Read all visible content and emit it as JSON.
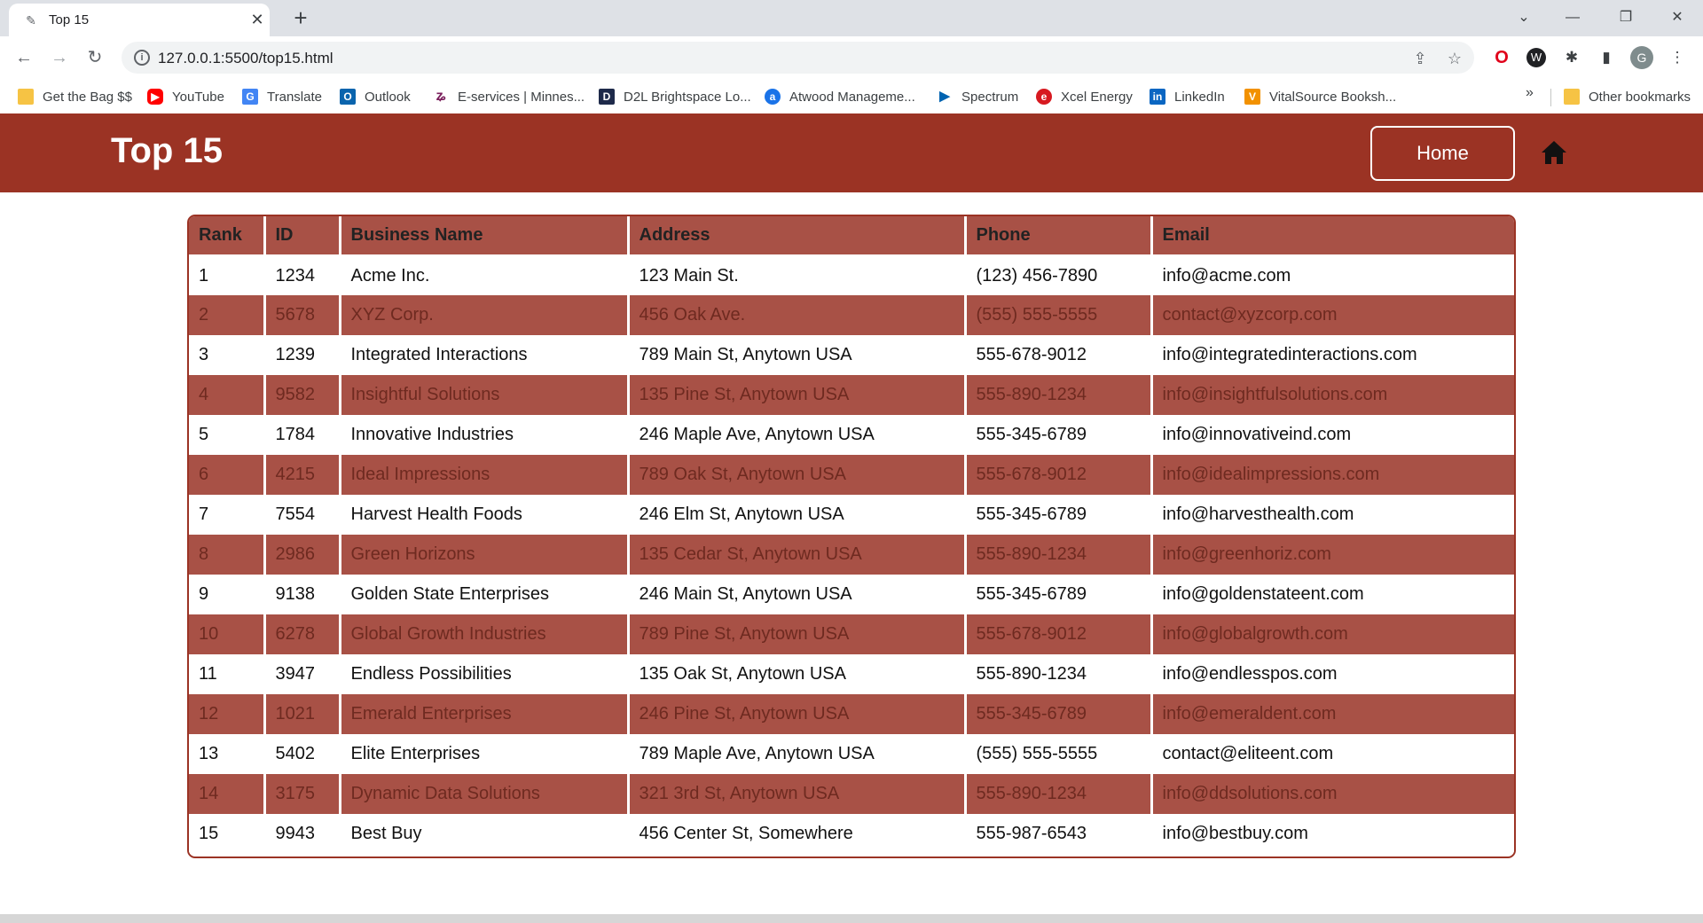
{
  "browser": {
    "tab_title": "Top 15",
    "url": "127.0.0.1:5500/top15.html",
    "bookmarks": [
      {
        "label": "Get the Bag $$",
        "icon": "folder-icon",
        "color": "#f6c344"
      },
      {
        "label": "YouTube",
        "icon": "youtube-icon",
        "color": "#ff0000"
      },
      {
        "label": "Translate",
        "icon": "translate-icon",
        "color": "#4285f4"
      },
      {
        "label": "Outlook",
        "icon": "outlook-icon",
        "color": "#0a64ad"
      },
      {
        "label": "E-services | Minnes...",
        "icon": "eservices-icon",
        "color": "#7a1f5c"
      },
      {
        "label": "D2L Brightspace Lo...",
        "icon": "d2l-icon",
        "color": "#1e2a4a"
      },
      {
        "label": "Atwood Manageme...",
        "icon": "atwood-icon",
        "color": "#1a73e8"
      },
      {
        "label": "Spectrum",
        "icon": "spectrum-icon",
        "color": "#0063b1"
      },
      {
        "label": "Xcel Energy",
        "icon": "xcel-icon",
        "color": "#d71920"
      },
      {
        "label": "LinkedIn",
        "icon": "linkedin-icon",
        "color": "#0a66c2"
      },
      {
        "label": "VitalSource Booksh...",
        "icon": "vitalsource-icon",
        "color": "#f29100"
      }
    ],
    "more_chevron": "»",
    "other_bookmarks": "Other bookmarks",
    "avatar_letter": "G"
  },
  "header": {
    "title": "Top 15",
    "home_label": "Home",
    "accent": "#9b3324"
  },
  "table": {
    "columns": [
      "Rank",
      "ID",
      "Business Name",
      "Address",
      "Phone",
      "Email"
    ],
    "rows": [
      [
        "1",
        "1234",
        "Acme Inc.",
        "123 Main St.",
        "(123) 456-7890",
        "info@acme.com"
      ],
      [
        "2",
        "5678",
        "XYZ Corp.",
        "456 Oak Ave.",
        "(555) 555-5555",
        "contact@xyzcorp.com"
      ],
      [
        "3",
        "1239",
        "Integrated Interactions",
        "789 Main St, Anytown USA",
        "555-678-9012",
        "info@integratedinteractions.com"
      ],
      [
        "4",
        "9582",
        "Insightful Solutions",
        "135 Pine St, Anytown USA",
        "555-890-1234",
        "info@insightfulsolutions.com"
      ],
      [
        "5",
        "1784",
        "Innovative Industries",
        "246 Maple Ave, Anytown USA",
        "555-345-6789",
        "info@innovativeind.com"
      ],
      [
        "6",
        "4215",
        "Ideal Impressions",
        "789 Oak St, Anytown USA",
        "555-678-9012",
        "info@idealimpressions.com"
      ],
      [
        "7",
        "7554",
        "Harvest Health Foods",
        "246 Elm St, Anytown USA",
        "555-345-6789",
        "info@harvesthealth.com"
      ],
      [
        "8",
        "2986",
        "Green Horizons",
        "135 Cedar St, Anytown USA",
        "555-890-1234",
        "info@greenhoriz.com"
      ],
      [
        "9",
        "9138",
        "Golden State Enterprises",
        "246 Main St, Anytown USA",
        "555-345-6789",
        "info@goldenstateent.com"
      ],
      [
        "10",
        "6278",
        "Global Growth Industries",
        "789 Pine St, Anytown USA",
        "555-678-9012",
        "info@globalgrowth.com"
      ],
      [
        "11",
        "3947",
        "Endless Possibilities",
        "135 Oak St, Anytown USA",
        "555-890-1234",
        "info@endlesspos.com"
      ],
      [
        "12",
        "1021",
        "Emerald Enterprises",
        "246 Pine St, Anytown USA",
        "555-345-6789",
        "info@emeraldent.com"
      ],
      [
        "13",
        "5402",
        "Elite Enterprises",
        "789 Maple Ave, Anytown USA",
        "(555) 555-5555",
        "contact@eliteent.com"
      ],
      [
        "14",
        "3175",
        "Dynamic Data Solutions",
        "321 3rd St, Anytown USA",
        "555-890-1234",
        "info@ddsolutions.com"
      ],
      [
        "15",
        "9943",
        "Best Buy",
        "456 Center St, Somewhere",
        "555-987-6543",
        "info@bestbuy.com"
      ]
    ]
  }
}
